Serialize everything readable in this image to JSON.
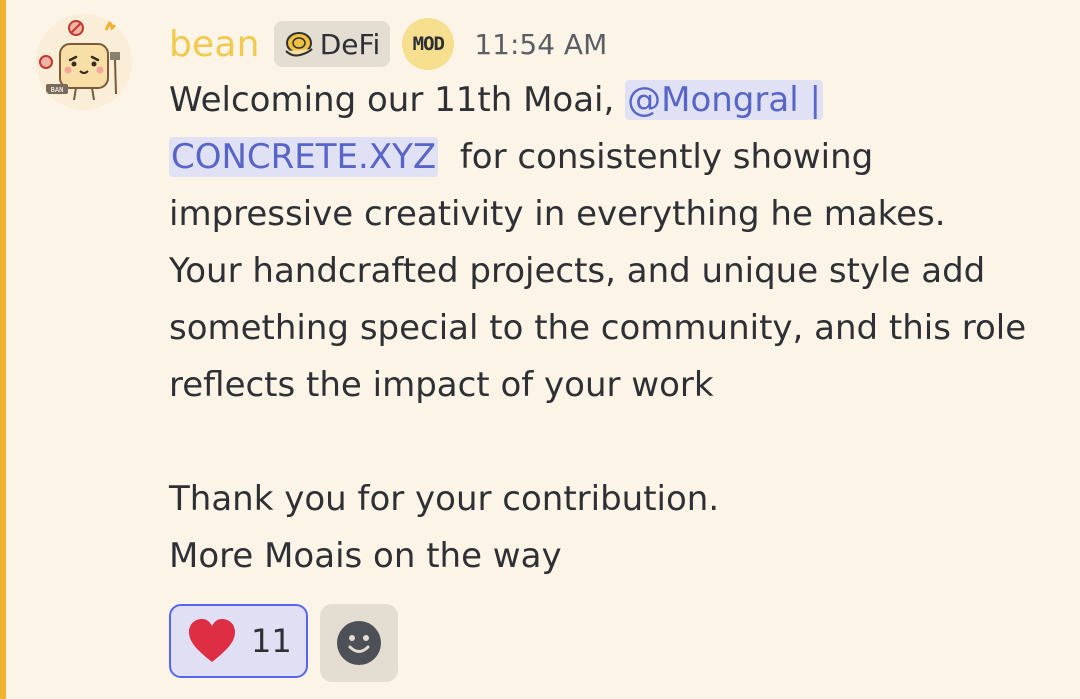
{
  "message": {
    "author": "bean",
    "role_tag": {
      "label": "DeFi",
      "icon": "coin-hand-icon"
    },
    "mod_badge": "MOD",
    "timestamp": "11:54 AM",
    "lines": {
      "l1_prefix": "Welcoming our 11th Moai, ",
      "mention_part1": "@Mongral |",
      "mention_part2": "CONCRETE.XYZ",
      "l2_suffix": "  for consistently showing",
      "l3": "impressive creativity in everything he makes.",
      "l4": "Your handcrafted projects, and unique style add",
      "l5": "something special to the community, and this role",
      "l6": "reflects the impact of your work",
      "l8": "Thank you for your contribution.",
      "l9": "More Moais on the way"
    }
  },
  "reactions": [
    {
      "emoji": "heart-icon",
      "count": "11"
    }
  ],
  "add_reaction_icon": "smile-icon",
  "colors": {
    "background": "#fcf5e7",
    "accent": "#f0b232",
    "username": "#f2c94c",
    "mention_bg": "#e0e1f5",
    "mention_text": "#5865c8",
    "reaction_border": "#5865f2"
  }
}
